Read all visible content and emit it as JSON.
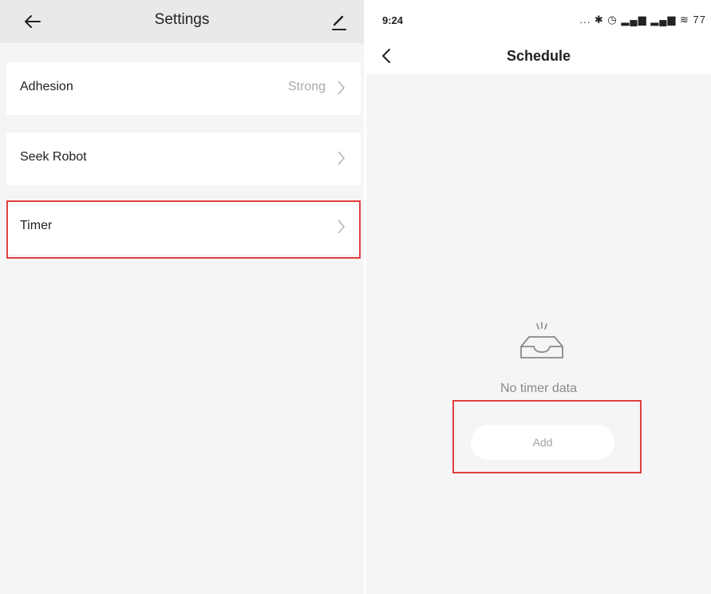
{
  "settings": {
    "title": "Settings",
    "items": [
      {
        "label": "Adhesion",
        "value": "Strong"
      },
      {
        "label": "Seek Robot",
        "value": ""
      },
      {
        "label": "Timer",
        "value": ""
      }
    ]
  },
  "status_bar": {
    "time": "9:24",
    "icons_text": "... ✱ ◷ ▂▄▆ ▂▄▆ ≋ 77"
  },
  "schedule": {
    "title": "Schedule",
    "empty_text": "No timer data",
    "add_label": "Add"
  },
  "colors": {
    "highlight": "#e0403f",
    "background": "#f5f5f5",
    "header_gray": "#e9e9e9"
  }
}
